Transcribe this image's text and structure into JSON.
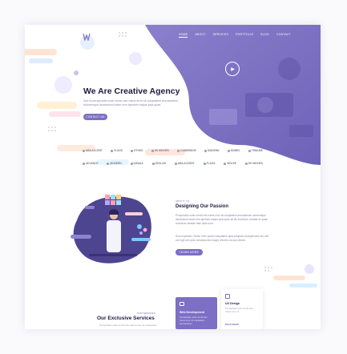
{
  "nav": {
    "items": [
      "HOME",
      "ABOUT",
      "SERVICES",
      "PORTFOLIO",
      "BLOG",
      "CONTACT"
    ]
  },
  "hero": {
    "title": "We Are Creative Agency",
    "text": "Sed ut perspiciatis unde omnis iste natus error sit voluptatem accusantium doloremque laudantium totam rem aperiam eaque ipsa quae.",
    "button": "CONTACT US"
  },
  "brands": {
    "row1": [
      "ABA ACCENT",
      "FLAGS",
      "ETHOS",
      "DS WICHES",
      "CAMBRIDGE",
      "MODERN",
      "HOMES",
      "TRIDUBE"
    ],
    "row2": [
      "ADVANCE",
      "MODERN",
      "KWAKA",
      "ZEOLON",
      "ABA ACCENT",
      "FLAGS",
      "WOLFE",
      "DS WICHES"
    ]
  },
  "about": {
    "label": "ABOUT US",
    "title": "Designing Our Passion",
    "para1": "Perspiciatis unde omnis iste natus error sit voluptatem accusantium doloremque laudantium totam rem aperiam eaque ipsa quae ab illo inventore veritatis et quasi architecto beatae vitae dicta sunt.",
    "para2": "Sunt explicabo. Nemo enim ipsam voluptatem quia voluptas sit aspernatur aut odit aut fugit sed quia consequuntur magni dolores eos qui ratione.",
    "button": "LEARN MORE"
  },
  "services": {
    "label": "OUR SERVICES",
    "title": "Our Exclusive Services",
    "text": "Perspiciatis unde omnis iste natus error sit voluptatem",
    "cards": [
      {
        "title": "Web Development",
        "text": "Perspiciatis unde omnis iste natus error sit voluptatem accusantium"
      },
      {
        "title": "UX Design",
        "text": "Perspiciatis unde omnis iste natus error sit",
        "link": "READ MORE"
      }
    ]
  },
  "colors": {
    "accent": "#7c6fc4",
    "dark": "#1f1b3d"
  }
}
